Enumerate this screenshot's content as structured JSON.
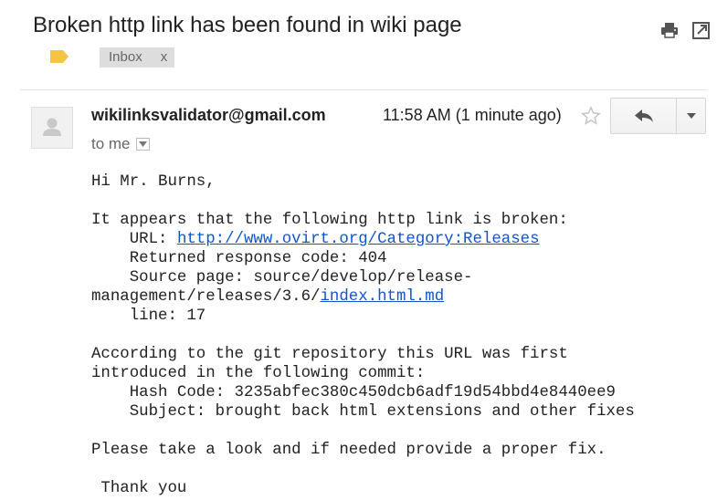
{
  "email": {
    "subject": "Broken http link has been found in wiki page",
    "label": "Inbox",
    "label_remove": "x",
    "sender": "wikilinksvalidator@gmail.com",
    "time": "11:58 AM (1 minute ago)",
    "recipient": "to me",
    "body": {
      "greeting": "Hi Mr. Burns,",
      "intro": "It appears that the following http link is broken:",
      "url_label": "    URL: ",
      "url": "http://www.ovirt.org/Category:Releases",
      "response": "    Returned response code: 404",
      "source_label": "    Source page: source/develop/release-",
      "source_cont": "management/releases/3.6/",
      "source_link": "index.html.md",
      "line": "    line: 17",
      "git_1": "According to the git repository this URL was first",
      "git_2": "introduced in the following commit:",
      "hash": "    Hash Code: 3235abfec380c450dcb6adf19d54bbd4e8440ee9",
      "commit_subject": "    Subject: brought back html extensions and other fixes",
      "request": "Please take a look and if needed provide a proper fix.",
      "thanks": " Thank you"
    }
  },
  "icons": {
    "label_tag": "tag-icon",
    "print": "print-icon",
    "new_window": "new-window-icon",
    "avatar": "avatar-icon",
    "star": "star-icon",
    "reply": "reply-icon",
    "more": "chevron-down-icon",
    "recipient_details": "chevron-down-icon"
  },
  "colors": {
    "label_tag": "#f4c542",
    "link": "#1155cc",
    "label_bg": "#dddddd"
  }
}
